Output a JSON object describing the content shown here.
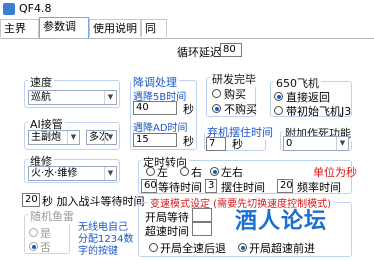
{
  "window": {
    "title": "QF4.8"
  },
  "tabs": [
    "主界面",
    "参数调整",
    "使用说明",
    "同意"
  ],
  "loop_delay": {
    "label": "循环延迟",
    "value": "80"
  },
  "speed": {
    "title": "速度",
    "selected": "巡航"
  },
  "fire_delay": {
    "title": "降调处理",
    "label": "遇降5B时间",
    "value": "40",
    "unit": "秒"
  },
  "ad": {
    "label": "遇降AD时间",
    "value": "15",
    "unit": "秒"
  },
  "research": {
    "title": "研发完毕",
    "opt_buy": "购买",
    "opt_nobuy": "不购买"
  },
  "plane": {
    "title": "650飞机",
    "opt_return": "直接返回",
    "opt_j3": "带初始飞机J3"
  },
  "ai": {
    "title": "AI接管",
    "selected1": "主副炮",
    "selected2": "多次"
  },
  "hold": {
    "title": "弃机摆住时间",
    "value": "7",
    "unit": "秒"
  },
  "extra": {
    "title": "附加作死功能",
    "selected": "0"
  },
  "repair": {
    "title": "维修",
    "selected": "火·水·维修"
  },
  "turn": {
    "title": "定时转向",
    "opt_left": "左",
    "opt_right": "右",
    "opt_lr": "左右",
    "unit_note": "单位为秒",
    "wait_value": "60",
    "wait_label": "等待时间",
    "hold_value": "3",
    "hold_label": "摆住时间",
    "freq_value": "20",
    "freq_label": "频率时间"
  },
  "join_wait": {
    "value": "20",
    "label": "秒 加入战斗等待时间"
  },
  "random": {
    "title": "随机鱼雷",
    "opt_yes": "是",
    "opt_no": "否"
  },
  "note": {
    "lines": [
      "无线电自己",
      "分配1234数",
      "字的按键"
    ]
  },
  "speed_mode": {
    "title": "变速模式设定 (需要先切换速度控制模式)",
    "open_label": "开局等待",
    "over_label": "超速时间",
    "open_value": "",
    "over_value": "",
    "opt_back": "开局全速后退",
    "opt_forward": "开局超速前进"
  },
  "watermark": "酒人论坛"
}
